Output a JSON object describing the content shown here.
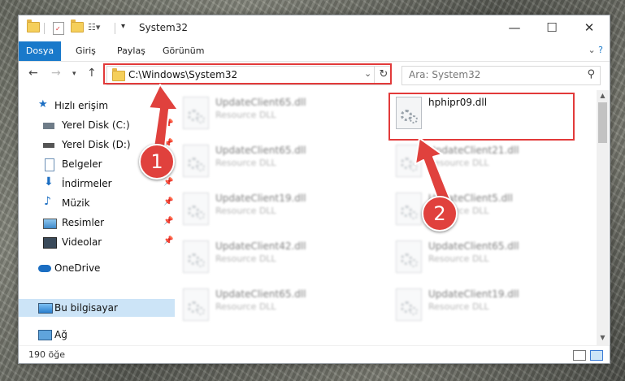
{
  "window": {
    "title": "System32"
  },
  "ribbon": {
    "tabs": [
      "Dosya",
      "Giriş",
      "Paylaş",
      "Görünüm"
    ]
  },
  "address": {
    "path": "C:\\Windows\\System32"
  },
  "search": {
    "placeholder": "Ara: System32"
  },
  "sidebar": {
    "items": [
      {
        "label": "Hızlı erişim",
        "icon": "star-icon"
      },
      {
        "label": "Yerel Disk (C:)",
        "icon": "drive-icon",
        "pinned": true
      },
      {
        "label": "Yerel Disk (D:)",
        "icon": "drive-icon",
        "pinned": true
      },
      {
        "label": "Belgeler",
        "icon": "document-icon",
        "pinned": true
      },
      {
        "label": "İndirmeler",
        "icon": "download-icon",
        "pinned": true
      },
      {
        "label": "Müzik",
        "icon": "music-icon",
        "pinned": true
      },
      {
        "label": "Resimler",
        "icon": "pictures-icon",
        "pinned": true
      },
      {
        "label": "Videolar",
        "icon": "video-icon",
        "pinned": true
      },
      {
        "label": "OneDrive",
        "icon": "cloud-icon"
      },
      {
        "label": "Bu bilgisayar",
        "icon": "computer-icon",
        "selected": true
      },
      {
        "label": "Ağ",
        "icon": "network-icon"
      }
    ]
  },
  "files": [
    {
      "name": "UpdateClient65.dll",
      "type": "Resource DLL"
    },
    {
      "name": "UpdateClient65.dll",
      "type": "Resource DLL"
    },
    {
      "name": "UpdateClient19.dll",
      "type": "Resource DLL"
    },
    {
      "name": "UpdateClient42.dll",
      "type": "Resource DLL"
    },
    {
      "name": "UpdateClient65.dll",
      "type": "Resource DLL"
    },
    {
      "name": "hphipr09.dll"
    },
    {
      "name": "UpdateClient21.dll",
      "type": "Resource DLL"
    },
    {
      "name": "UpdateClient5.dll",
      "type": "Resource DLL"
    },
    {
      "name": "UpdateClient65.dll",
      "type": "Resource DLL"
    },
    {
      "name": "UpdateClient19.dll",
      "type": "Resource DLL"
    }
  ],
  "status": {
    "item_count": "190 öğe"
  },
  "annotations": {
    "badge_1": "1",
    "badge_2": "2",
    "color": "#e0413d"
  },
  "colors": {
    "accent": "#1979ca",
    "selection": "#cce4f7"
  }
}
